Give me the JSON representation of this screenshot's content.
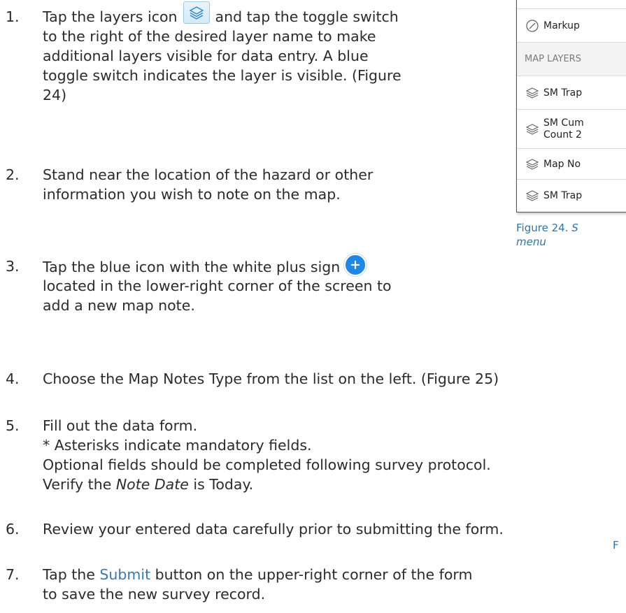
{
  "steps": [
    {
      "number": "1.",
      "lines": [
        {
          "pre": "Tap the layers icon",
          "post": "and tap the toggle switch"
        },
        "to the right of the desired layer name to make",
        "additional layers visible for data entry. A blue",
        "toggle switch indicates the layer is visible. (Figure",
        "24)"
      ]
    },
    {
      "number": "2.",
      "lines": [
        "Stand near the location of the hazard or other",
        "information you wish to note on the map."
      ]
    },
    {
      "number": "3.",
      "lines": [
        "Tap the blue icon with the white plus sign",
        "located in the lower-right corner of the screen to",
        "add a new map note."
      ]
    },
    {
      "number": "4.",
      "lines": [
        "Choose the Map Notes Type from the list on the left.  (Figure 25)"
      ]
    },
    {
      "number": "5.",
      "lines": [
        "Fill out the data form.",
        "* Asterisks indicate mandatory fields.",
        "Optional fields should be completed following survey protocol.",
        {
          "pre": "Verify the ",
          "italic": "Note Date",
          "post": " is Today."
        }
      ]
    },
    {
      "number": "6.",
      "lines": [
        "Review your entered data carefully prior to submitting the form."
      ]
    },
    {
      "number": "7.",
      "lines": [
        {
          "pre": "Tap the ",
          "link": "Submit",
          "post": " button on the upper-right corner of the form"
        },
        "to save the new survey record."
      ]
    }
  ],
  "panel": {
    "markup_label": "Markup",
    "section_header": "MAP LAYERS",
    "layers": [
      {
        "label": "SM Trap",
        "icon": "layers-icon"
      },
      {
        "label": "SM Cum",
        "label2": "Count 2",
        "icon": "layers-icon"
      },
      {
        "label": "Map No",
        "icon": "layers-icon"
      },
      {
        "label": "SM Trap",
        "icon": "layers-icon"
      }
    ]
  },
  "caption": {
    "prefix": "Figure 24. ",
    "italic_1": "S",
    "italic_2": "menu"
  },
  "stray_letter": "F",
  "colors": {
    "accent_blue": "#1e88e5",
    "link_blue": "#3b78b0",
    "caption_blue": "#2f74a8"
  }
}
